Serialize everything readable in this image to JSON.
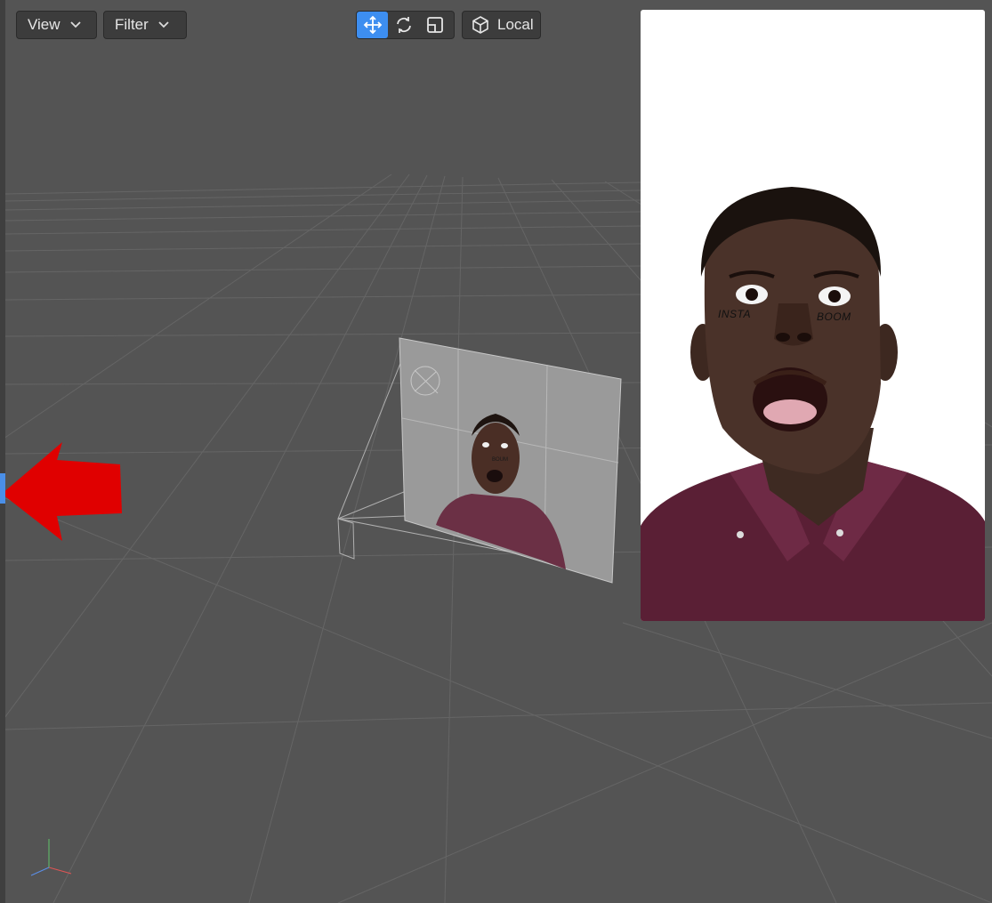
{
  "toolbar": {
    "view_label": "View",
    "filter_label": "Filter",
    "space_label": "Local",
    "tools": [
      {
        "icon": "move-icon",
        "active": true
      },
      {
        "icon": "rotate-icon",
        "active": false
      },
      {
        "icon": "scale-icon",
        "active": false
      }
    ]
  },
  "preview": {
    "face_text_left": "INSTA",
    "face_text_right": "BOOM"
  },
  "scene": {
    "plane_text": "BOUM"
  },
  "colors": {
    "viewport_bg": "#545454",
    "accent": "#3d8ef0",
    "arrow": "#e00000",
    "shirt": "#5a1f35"
  }
}
